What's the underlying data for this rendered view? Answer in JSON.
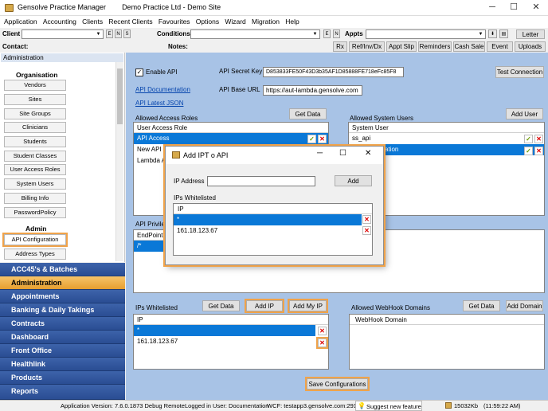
{
  "window": {
    "title": "Gensolve Practice Manager",
    "subtitle": "Demo Practice Ltd - Demo Site",
    "minimize": "─",
    "maximize": "☐",
    "close": "✕"
  },
  "menu": [
    "Application",
    "Accounting",
    "Clients",
    "Recent Clients",
    "Favourites",
    "Options",
    "Wizard",
    "Migration",
    "Help"
  ],
  "toolbar": {
    "client_label": "Client",
    "conditions_label": "Conditions",
    "appts_label": "Appts",
    "letter_button": "Letter",
    "contact_label": "Contact:",
    "notes_label": "Notes:",
    "e_btn": "E",
    "n_btn": "N",
    "s_btn": "S",
    "buttons": [
      "Rx",
      "Ref/Inv/Dx",
      "Appt Slip",
      "Reminders",
      "Cash Sale",
      "Event",
      "Uploads"
    ]
  },
  "sidebar": {
    "header": "Administration",
    "organisation_title": "Organisation",
    "organisation_items": [
      "Vendors",
      "Sites",
      "Site Groups",
      "Clinicians",
      "Students",
      "Student Classes",
      "User Access Roles",
      "System Users",
      "Billing Info",
      "PasswordPolicy"
    ],
    "admin_title": "Admin",
    "admin_items": [
      "API Configuration",
      "Address Types"
    ],
    "nav": [
      "ACC45's & Batches",
      "Administration",
      "Appointments",
      "Banking & Daily Takings",
      "Contracts",
      "Dashboard",
      "Front Office",
      "Healthlink",
      "Products",
      "Reports"
    ],
    "active_nav": "Administration"
  },
  "api": {
    "enable_label": "Enable API",
    "enable_checked": true,
    "secret_key_label": "API Secret Key",
    "secret_key_value": "D853833FE50F43D3b35AF1D85888FE718eFc85F8",
    "test_connection": "Test Connection",
    "doc_link": "API Documentation",
    "base_url_label": "API Base URL",
    "base_url_value": "https://aut-lambda.gensolve.com",
    "latest_json": "API Latest JSON"
  },
  "access_roles": {
    "title": "Allowed Access Roles",
    "get_data": "Get Data",
    "column": "User Access Role",
    "rows": [
      "API Access",
      "New API Ta",
      "Lambda AP"
    ]
  },
  "system_users": {
    "title": "Allowed System Users",
    "add_user": "Add User",
    "column": "System User",
    "rows": [
      "ss_api",
      "ation"
    ]
  },
  "privileges": {
    "title": "API Privileg",
    "column": "EndPoint",
    "rows": [
      "/*"
    ]
  },
  "ips_whitelisted": {
    "title": "IPs Whitelisted",
    "get_data": "Get Data",
    "add_ip": "Add IP",
    "add_my_ip": "Add My IP",
    "column": "IP",
    "rows": [
      "*",
      "161.18.123.67"
    ]
  },
  "webhook": {
    "title": "Allowed WebHook Domains",
    "get_data": "Get Data",
    "add_domain": "Add Domain",
    "column": "WebHook Domain"
  },
  "save_button": "Save Configurations",
  "dialog": {
    "title": "Add IPT o API",
    "ip_label": "IP Address",
    "add_button": "Add",
    "list_title": "IPs Whitelisted",
    "column": "IP",
    "rows": [
      "*",
      "161.18.123.67"
    ]
  },
  "status": {
    "version": "Application Version: 7.6.0.1873 Debug Remote",
    "user": "Logged in User: Documentation",
    "wcf": "WCF: testapp3.gensolve.com:291",
    "suggest": "Suggest new feature",
    "memory": "15032Kb",
    "time": "(11:59:22 AM)"
  },
  "colors": {
    "nav_blue": "#2a4d93",
    "nav_active": "#e79e2f",
    "main_bg": "#a8c3e6",
    "selection": "#0a78d7",
    "highlight": "#f0a34a"
  }
}
